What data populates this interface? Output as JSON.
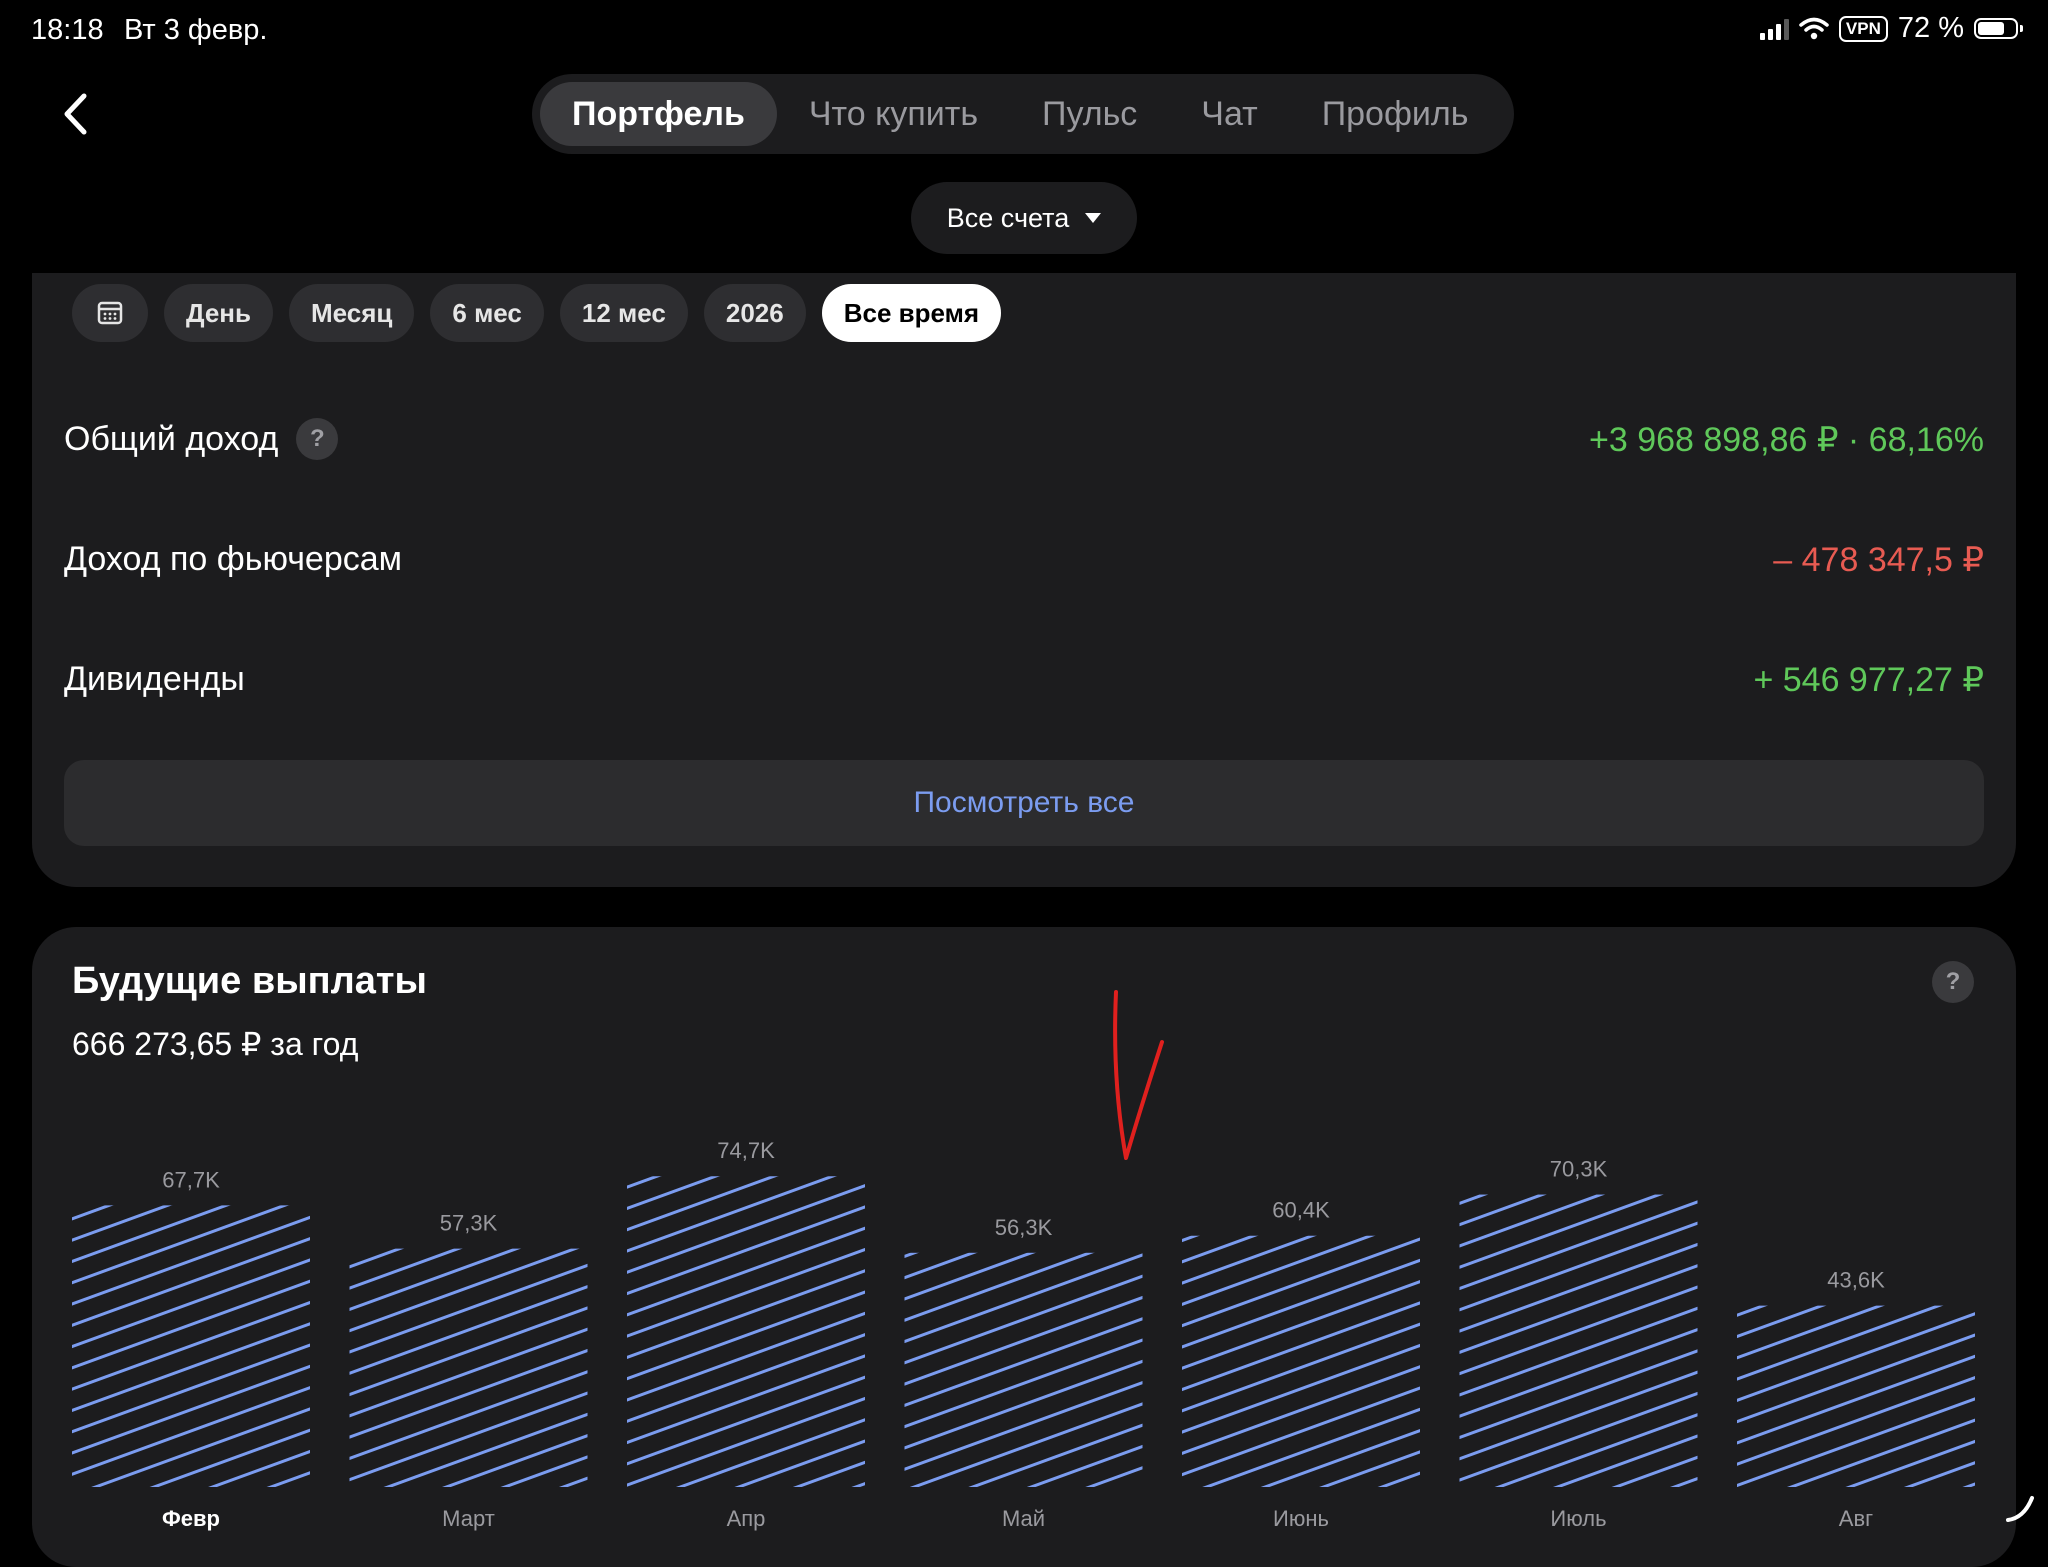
{
  "status_bar": {
    "time": "18:18",
    "date": "Вт 3 февр.",
    "vpn": "VPN",
    "battery_text": "72 %",
    "battery_level": 0.72
  },
  "nav": {
    "tabs": [
      {
        "label": "Портфель",
        "active": true
      },
      {
        "label": "Что купить",
        "active": false
      },
      {
        "label": "Пульс",
        "active": false
      },
      {
        "label": "Чат",
        "active": false
      },
      {
        "label": "Профиль",
        "active": false
      }
    ]
  },
  "accounts": {
    "selected": "Все счета"
  },
  "periods": {
    "items": [
      "День",
      "Месяц",
      "6 мес",
      "12 мес",
      "2026",
      "Все время"
    ],
    "active": "Все время"
  },
  "income": {
    "total": {
      "label": "Общий доход",
      "help": "?",
      "value": "+3 968 898,86 ₽ · 68,16%",
      "color": "#5fc85a"
    },
    "futures": {
      "label": "Доход по фьючерсам",
      "value": "– 478 347,5 ₽",
      "color": "#e85b52"
    },
    "dividends": {
      "label": "Дивиденды",
      "value": "+ 546 977,27 ₽",
      "color": "#5fc85a"
    },
    "view_all": "Посмотреть все",
    "view_all_color": "#7b9cf0"
  },
  "payouts": {
    "title": "Будущие выплаты",
    "subtitle": "666 273,65 ₽ за год",
    "help": "?"
  },
  "chart_data": {
    "type": "bar",
    "categories": [
      "Февр",
      "Март",
      "Апр",
      "Май",
      "Июнь",
      "Июль",
      "Авг"
    ],
    "values": [
      67.7,
      57.3,
      74.7,
      56.3,
      60.4,
      70.3,
      43.6
    ],
    "value_labels": [
      "67,7K",
      "57,3K",
      "74,7K",
      "56,3K",
      "60,4K",
      "70,3K",
      "43,6K"
    ],
    "active_category": "Февр",
    "bar_color": "#7b9cf0",
    "pattern": "diagonal-stripes"
  }
}
